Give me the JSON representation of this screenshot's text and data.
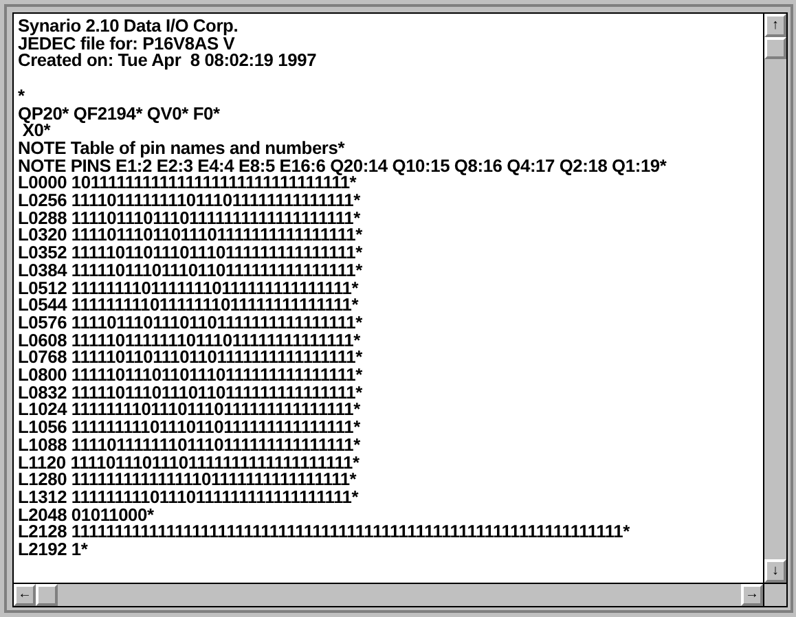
{
  "document": {
    "header_lines": [
      "Synario 2.10 Data I/O Corp.",
      "JEDEC file for: P16V8AS V",
      "Created on: Tue Apr  8 08:02:19 1997"
    ],
    "body_lines": [
      "*",
      "QP20* QF2194* QV0* F0*",
      " X0*",
      "NOTE Table of pin names and numbers*",
      "NOTE PINS E1:2 E2:3 E4:4 E8:5 E16:6 Q20:14 Q10:15 Q8:16 Q4:17 Q2:18 Q1:19*",
      "L0000 10111111111111111111111111111111*",
      "L0256 11110111111110111011111111111111*",
      "L0288 11110111011101111111111111111111*",
      "L0320 11110111011011101111111111111111*",
      "L0352 11111011011101110111111111111111*",
      "L0384 11111011101110110111111111111111*",
      "L0512 11111111011111110111111111111111*",
      "L0544 11111111101111111011111111111111*",
      "L0576 11110111011101101111111111111111*",
      "L0608 11111011111110111011111111111111*",
      "L0768 11111011011101101111111111111111*",
      "L0800 11111011101101110111111111111111*",
      "L0832 11111011101110110111111111111111*",
      "L1024 11111111011101110111111111111111*",
      "L1056 11111111101110110111111111111111*",
      "L1088 11110111111101110111111111111111*",
      "L1120 11110111011101111111111111111111*",
      "L1280 11111111111111101111111111111111*",
      "L1312 11111111101110111111111111111111*",
      "L2048 01011000*",
      "L2128 1111111111111111111111111111111111111111111111111111111111111111*",
      "L2192 1*"
    ]
  },
  "scrollbars": {
    "up": "↑",
    "down": "↓",
    "left": "←",
    "right": "→"
  }
}
